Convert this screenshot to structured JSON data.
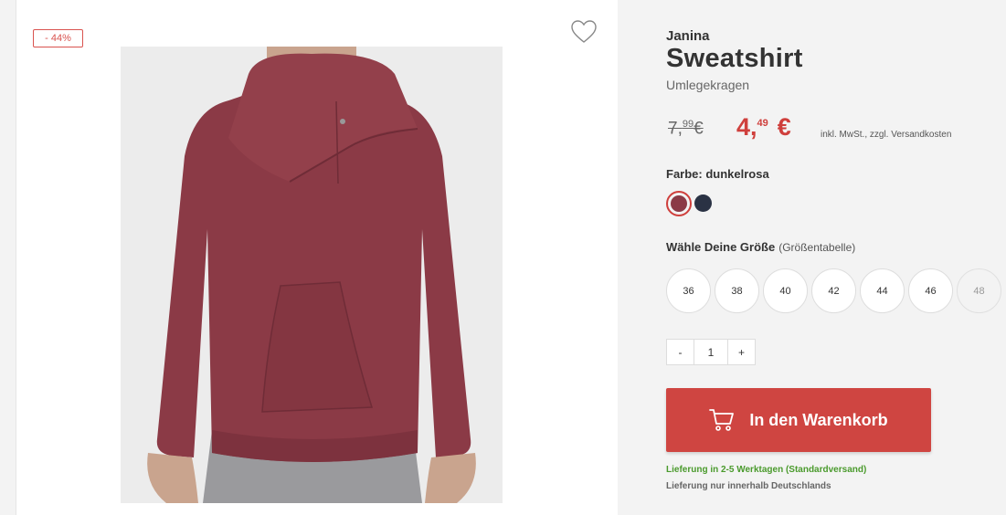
{
  "badge": {
    "discount": "- 44%"
  },
  "icons": {
    "wishlist": "heart-outline-icon",
    "cart": "shopping-cart-icon"
  },
  "product": {
    "brand": "Janina",
    "title": "Sweatshirt",
    "subtitle": "Umlegekragen",
    "image_alt": "dunkelrosa Sweatshirt mit Umlegekragen"
  },
  "price": {
    "old_main": "7,",
    "old_cents": "99",
    "old_currency": "€",
    "new_main": "4,",
    "new_cents": "49",
    "new_currency": "€",
    "tax_note": "inkl. MwSt., zzgl. Versandkosten"
  },
  "colors": {
    "label": "Farbe: dunkelrosa",
    "options": [
      {
        "name": "dunkelrosa",
        "hex": "#8b3a46",
        "selected": true
      },
      {
        "name": "navy",
        "hex": "#2a3244",
        "selected": false
      }
    ]
  },
  "sizes": {
    "label": "Wähle Deine Größe",
    "chart_link": "(Größentabelle)",
    "options": [
      "36",
      "38",
      "40",
      "42",
      "44",
      "46",
      "48"
    ],
    "unavailable": [
      "48"
    ]
  },
  "quantity": {
    "minus": "-",
    "value": "1",
    "plus": "+"
  },
  "cart": {
    "label": "In den Warenkorb"
  },
  "delivery": {
    "time": "Lieferung in 2-5 Werktagen (Standardversand)",
    "region": "Lieferung nur innerhalb Deutschlands"
  },
  "theme": {
    "accent": "#cf4541",
    "success": "#4a9a2c",
    "sweatshirt": "#8b3a46"
  }
}
